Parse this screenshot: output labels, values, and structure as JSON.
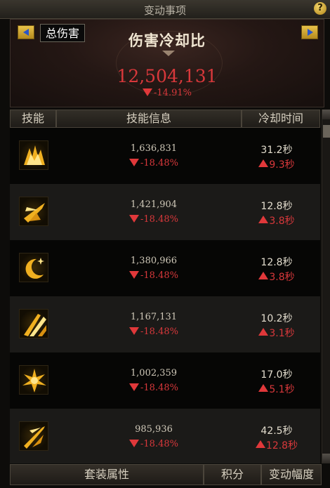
{
  "window": {
    "title": "变动事项"
  },
  "header": {
    "dropdown_value": "总伤害",
    "title": "伤害冷却比",
    "total": "12,504,131",
    "total_delta": "-14.91%"
  },
  "columns": {
    "skill": "技能",
    "info": "技能信息",
    "cooldown": "冷却时间"
  },
  "rows": [
    {
      "icon": "flame-burst-icon",
      "damage": "1,636,831",
      "damage_delta": "-18.48%",
      "cooldown": "31.2秒",
      "cooldown_delta": "9.3秒"
    },
    {
      "icon": "spear-thrust-icon",
      "damage": "1,421,904",
      "damage_delta": "-18.48%",
      "cooldown": "12.8秒",
      "cooldown_delta": "3.8秒"
    },
    {
      "icon": "crescent-moon-icon",
      "damage": "1,380,966",
      "damage_delta": "-18.48%",
      "cooldown": "12.8秒",
      "cooldown_delta": "3.8秒"
    },
    {
      "icon": "slash-strikes-icon",
      "damage": "1,167,131",
      "damage_delta": "-18.48%",
      "cooldown": "10.2秒",
      "cooldown_delta": "3.1秒"
    },
    {
      "icon": "starburst-icon",
      "damage": "1,002,359",
      "damage_delta": "-18.48%",
      "cooldown": "17.0秒",
      "cooldown_delta": "5.1秒"
    },
    {
      "icon": "dash-lance-icon",
      "damage": "985,936",
      "damage_delta": "-18.48%",
      "cooldown": "42.5秒",
      "cooldown_delta": "12.8秒"
    }
  ],
  "footer": {
    "set_attributes": "套装属性",
    "points": "积分",
    "change_range": "变动幅度"
  },
  "colors": {
    "accent_red": "#d8383b",
    "gold": "#e8c24a"
  }
}
